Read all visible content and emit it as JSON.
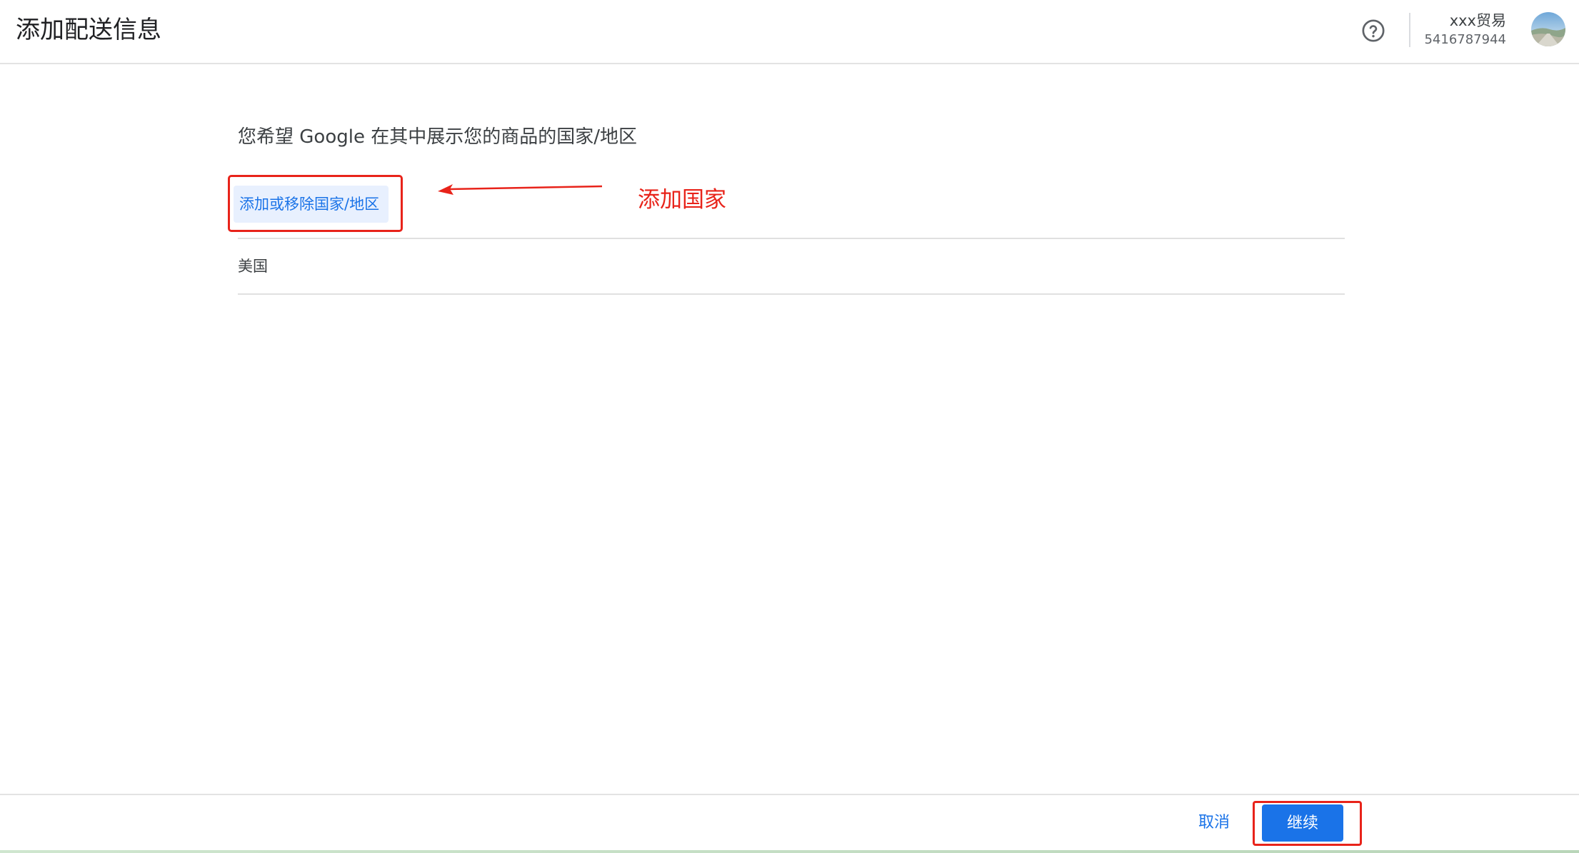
{
  "header": {
    "title": "添加配送信息",
    "help_icon": "help-circle-icon",
    "account_name": "xxx贸易",
    "account_id": "5416787944",
    "avatar_icon": "account-avatar-icon"
  },
  "main": {
    "question": "您希望 Google 在其中展示您的商品的国家/地区",
    "add_remove_label": "添加或移除国家/地区",
    "countries": [
      "美国"
    ]
  },
  "footer": {
    "cancel_label": "取消",
    "continue_label": "继续"
  },
  "annotation": {
    "label": "添加国家",
    "color": "#e8231a"
  },
  "colors": {
    "accent": "#1a73e8",
    "accent_light": "#e8f0fe"
  }
}
